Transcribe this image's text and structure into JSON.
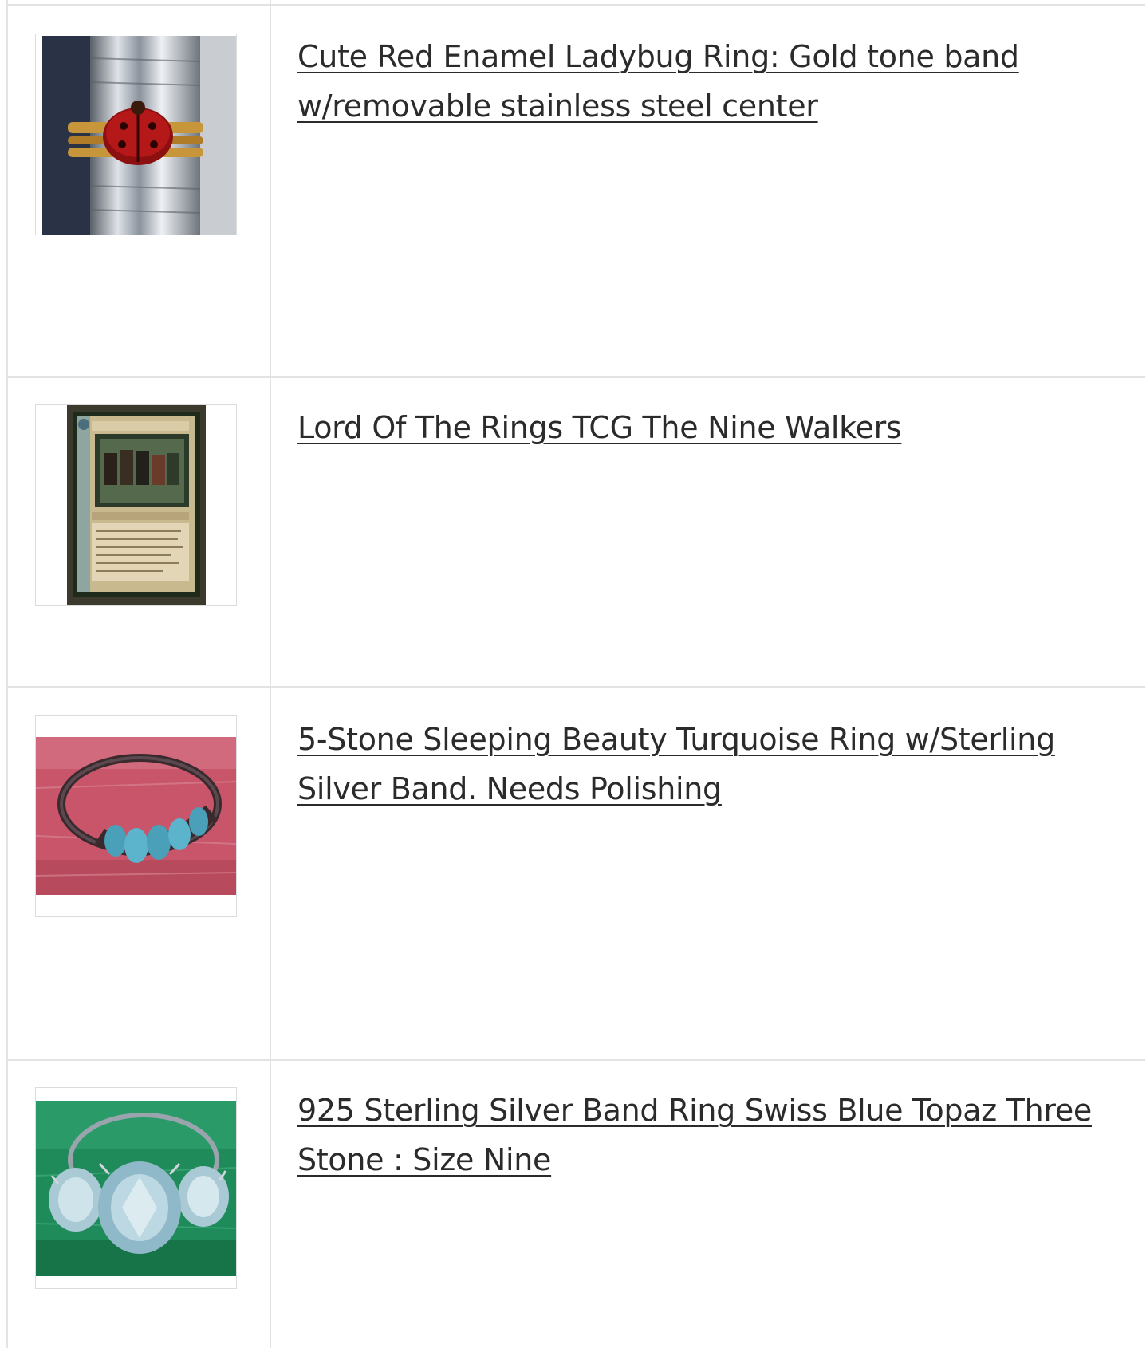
{
  "listings": [
    {
      "title": "Cute Red Enamel Ladybug Ring: Gold tone band w/removable stainless steel center",
      "thumbnail_icon": "ladybug-ring-photo"
    },
    {
      "title": "Lord Of The Rings TCG The Nine Walkers",
      "thumbnail_icon": "trading-card-photo"
    },
    {
      "title": "5-Stone Sleeping Beauty Turquoise Ring w/Sterling Silver Band. Needs Polishing",
      "thumbnail_icon": "turquoise-ring-photo"
    },
    {
      "title": "925 Sterling Silver Band Ring Swiss Blue Topaz Three Stone : Size Nine",
      "thumbnail_icon": "topaz-ring-photo"
    }
  ],
  "colors": {
    "border": "#e3e3e3",
    "link_text": "#2b2b2b",
    "background": "#ffffff"
  }
}
